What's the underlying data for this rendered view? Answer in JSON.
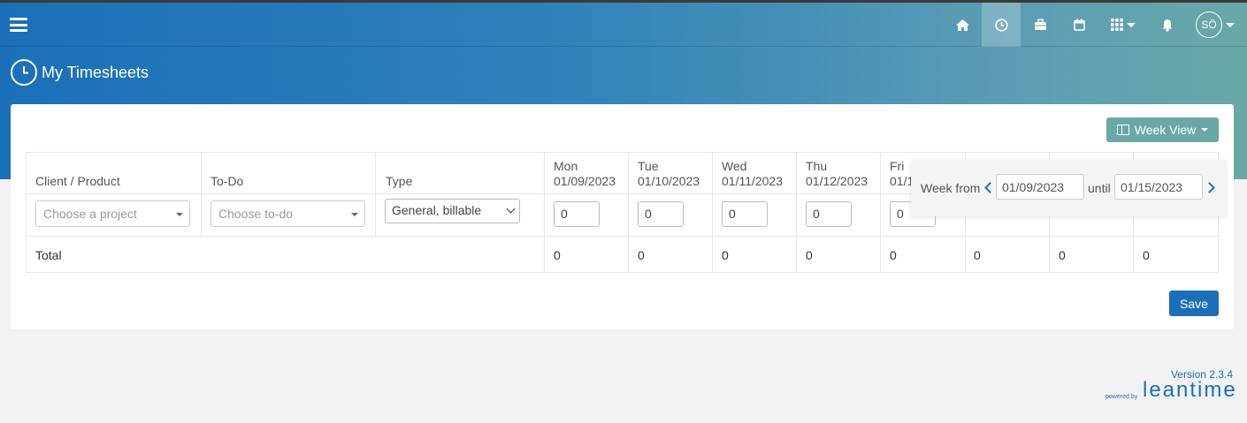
{
  "header": {
    "page_title": "My Timesheets",
    "avatar_initials": "SÖ",
    "nav_icons": [
      "home-icon",
      "clock-icon",
      "briefcase-icon",
      "calendar-icon",
      "grid-icon",
      "bell-icon"
    ]
  },
  "toolbar": {
    "week_view_label": "Week View"
  },
  "table": {
    "headers": {
      "client_product": "Client / Product",
      "todo": "To-Do",
      "type": "Type"
    },
    "days": [
      {
        "name": "Mon",
        "date": "01/09/2023"
      },
      {
        "name": "Tue",
        "date": "01/10/2023"
      },
      {
        "name": "Wed",
        "date": "01/11/2023"
      },
      {
        "name": "Thu",
        "date": "01/12/2023"
      },
      {
        "name": "Fri",
        "date": "01/1"
      }
    ],
    "row": {
      "project_placeholder": "Choose a project",
      "todo_placeholder": "Choose to-do",
      "type_value": "General, billable",
      "hours": [
        "0",
        "0",
        "0",
        "0",
        "0"
      ]
    },
    "total_label": "Total",
    "totals": [
      "0",
      "0",
      "0",
      "0",
      "0",
      "0",
      "0",
      "0"
    ]
  },
  "week_picker": {
    "from_label": "Week from",
    "from_value": "01/09/2023",
    "until_label": "until",
    "until_value": "01/15/2023"
  },
  "save_label": "Save",
  "footer": {
    "version": "Version 2.3.4",
    "powered_by": "powered by",
    "brand": "leantime"
  },
  "colors": {
    "primary": "#1b6fb8",
    "accent": "#6aa8a8"
  }
}
